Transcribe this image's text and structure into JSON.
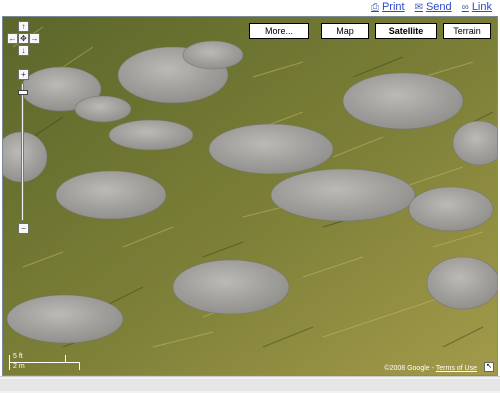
{
  "toplinks": {
    "print": "Print",
    "send": "Send",
    "link": "Link",
    "print_icon": "printer-icon",
    "send_icon": "mail-icon",
    "link_icon": "link-icon"
  },
  "map_types": {
    "more": "More...",
    "map": "Map",
    "satellite": "Satellite",
    "terrain": "Terrain",
    "active": "Satellite"
  },
  "navigation": {
    "pan_up": "↑",
    "pan_left": "←",
    "pan_center": "✥",
    "pan_right": "→",
    "pan_down": "↓",
    "zoom_in": "+",
    "zoom_out": "−",
    "zoom_level_fraction": 0.05
  },
  "scale": {
    "top_label": "5 ft",
    "bottom_label": "2 m"
  },
  "copyright": {
    "text": "©2008 Google - ",
    "terms": "Terms of Use"
  },
  "colors": {
    "grass_dark": "#4f5a22",
    "grass_light": "#b7b15a",
    "elephant": "#a7a6a3"
  }
}
